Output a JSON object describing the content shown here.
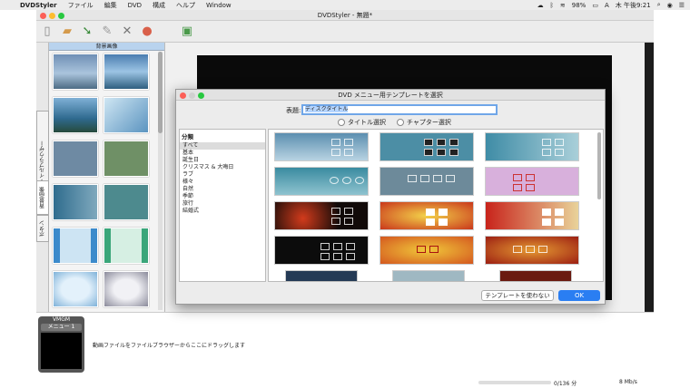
{
  "menubar": {
    "app": "DVDStyler",
    "items": [
      "ファイル",
      "編集",
      "DVD",
      "構成",
      "ヘルプ",
      "Window"
    ],
    "battery": "98%",
    "input": "A",
    "clock": "木 午後9:21"
  },
  "window": {
    "title": "DVDStyler - 無題*"
  },
  "sidebar": {
    "header": "背景画像",
    "tabs": [
      "ファイルブラウザー",
      "背景画像",
      "ボタン"
    ]
  },
  "bottom": {
    "vmgm": "VMGM",
    "menu": "メニュー 1",
    "hint": "動画ファイルをファイルブラウザーからここにドラッグします"
  },
  "status": {
    "size": "0/136 分",
    "rate": "8 Mb/s"
  },
  "dialog": {
    "title": "DVD メニュー用テンプレートを選択",
    "title_label": "表題:",
    "title_value": "ディスクタイトル",
    "radio1": "タイトル選択",
    "radio2": "チャプター選択",
    "cat_header": "分類",
    "categories": [
      "すべて",
      "基本",
      "誕生日",
      "クリスマス & 大晦日",
      "ラブ",
      "様々",
      "自然",
      "季節",
      "旅行",
      "結婚式"
    ],
    "btn_no_template": "テンプレートを使わない",
    "btn_ok": "OK"
  },
  "colors": {
    "accent": "#2a7ef2",
    "selection": "#b9d3ee"
  }
}
